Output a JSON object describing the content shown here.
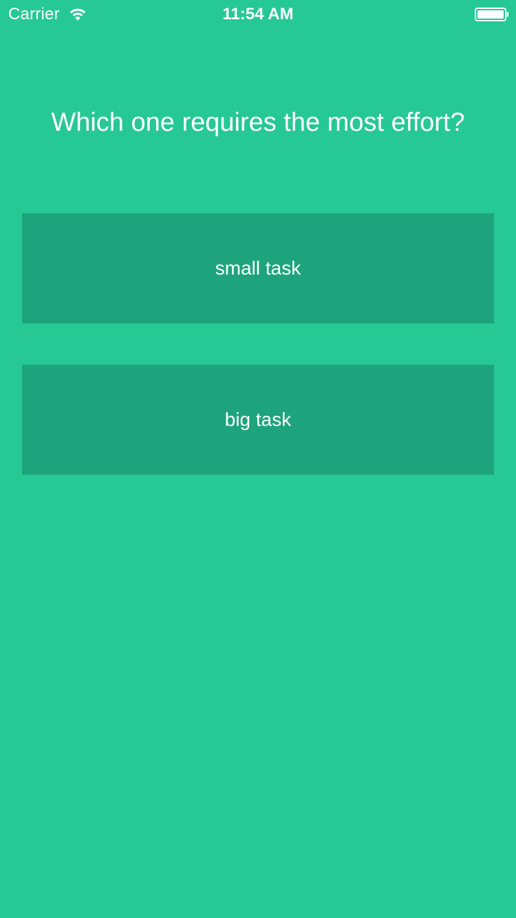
{
  "status_bar": {
    "carrier": "Carrier",
    "time": "11:54 AM",
    "wifi_icon": "wifi-icon",
    "battery_icon": "battery-icon"
  },
  "quiz": {
    "question": "Which one requires the most effort?",
    "answers": [
      {
        "label": "small task"
      },
      {
        "label": "big task"
      }
    ]
  },
  "colors": {
    "background": "#26c893",
    "button": "#1ea47c",
    "text": "#ffffff"
  }
}
